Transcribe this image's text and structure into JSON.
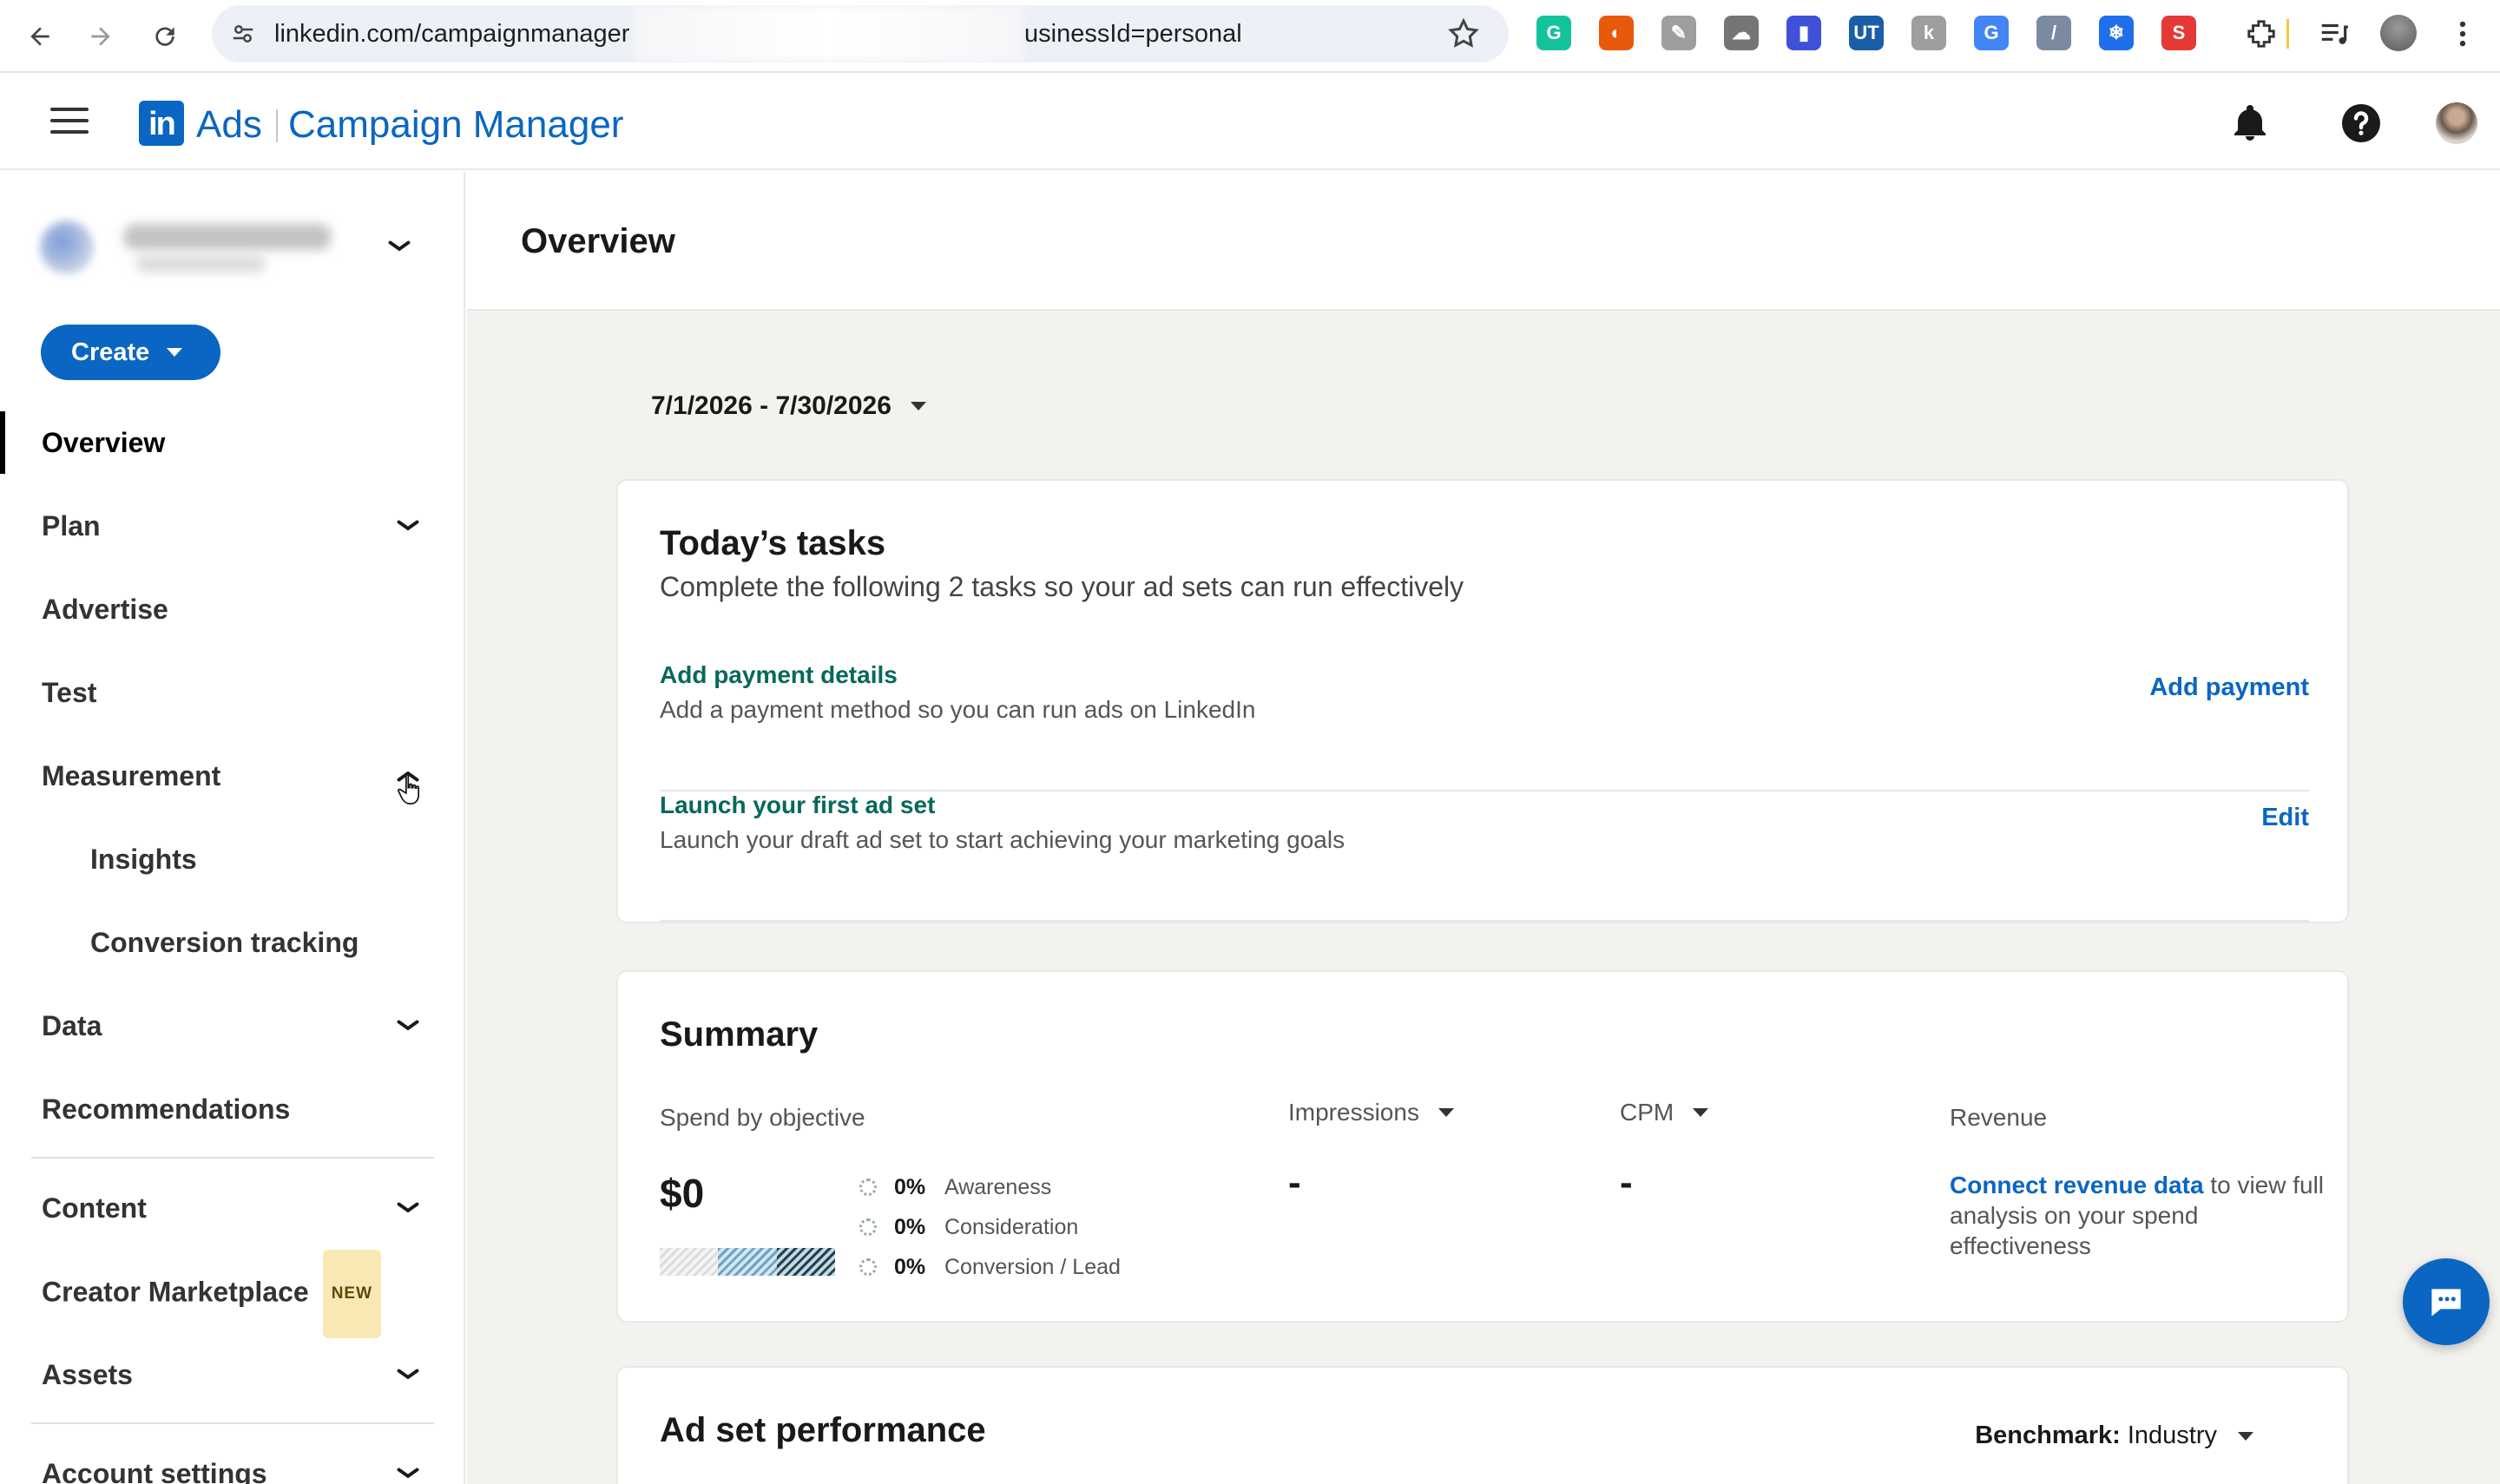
{
  "browser": {
    "url_visible_start": "linkedin.com/campaignmanager",
    "url_visible_end": "usinessId=personal",
    "extensions": [
      {
        "name": "grammarly-icon",
        "color": "#15c39a",
        "glyph": "G"
      },
      {
        "name": "extension-orange-icon",
        "color": "#e8590c",
        "glyph": "◐"
      },
      {
        "name": "extension-notes-icon",
        "color": "#9e9e9e",
        "glyph": "✎"
      },
      {
        "name": "extension-cloud-icon",
        "color": "#757575",
        "glyph": "☁"
      },
      {
        "name": "extension-blue-bookmark-icon",
        "color": "#3f51d8",
        "glyph": "▮"
      },
      {
        "name": "extension-ut-icon",
        "color": "#1a5ea8",
        "glyph": "UT"
      },
      {
        "name": "extension-gray-icon",
        "color": "#9e9e9e",
        "glyph": "k"
      },
      {
        "name": "google-translate-icon",
        "color": "#4285f4",
        "glyph": "G"
      },
      {
        "name": "extension-pen-icon",
        "color": "#7a8aa0",
        "glyph": "/"
      },
      {
        "name": "extension-snowflake-icon",
        "color": "#1f6feb",
        "glyph": "❄"
      },
      {
        "name": "extension-red-s-icon",
        "color": "#e53935",
        "glyph": "S"
      }
    ]
  },
  "header": {
    "logo_text": "in",
    "brand_ads": "Ads",
    "brand_product": "Campaign Manager"
  },
  "sidebar": {
    "create_label": "Create",
    "items": [
      {
        "label": "Overview",
        "active": true,
        "chevron": "none"
      },
      {
        "label": "Plan",
        "chevron": "down"
      },
      {
        "label": "Advertise",
        "chevron": "none"
      },
      {
        "label": "Test",
        "chevron": "none"
      },
      {
        "label": "Measurement",
        "chevron": "up"
      },
      {
        "label": "Insights",
        "sub": true
      },
      {
        "label": "Conversion tracking",
        "sub": true
      },
      {
        "label": "Data",
        "chevron": "down"
      },
      {
        "label": "Recommendations",
        "chevron": "none"
      },
      {
        "label": "Content",
        "chevron": "down"
      },
      {
        "label": "Creator Marketplace",
        "badge": "NEW"
      },
      {
        "label": "Assets",
        "chevron": "down"
      },
      {
        "label": "Account settings",
        "chevron": "down"
      }
    ]
  },
  "main": {
    "title": "Overview",
    "date_range": "7/1/2026 - 7/30/2026",
    "tasks": {
      "title": "Today’s tasks",
      "subtitle": "Complete the following 2 tasks so your ad sets can run effectively",
      "items": [
        {
          "title": "Add payment details",
          "description": "Add a payment method so you can run ads on LinkedIn",
          "action": "Add payment"
        },
        {
          "title": "Launch your first ad set",
          "description": "Launch your draft ad set to start achieving your marketing goals",
          "action": "Edit"
        }
      ]
    },
    "summary": {
      "title": "Summary",
      "spend_label": "Spend by objective",
      "spend_value": "$0",
      "objectives": [
        {
          "pct": "0%",
          "name": "Awareness"
        },
        {
          "pct": "0%",
          "name": "Consideration"
        },
        {
          "pct": "0%",
          "name": "Conversion / Lead"
        }
      ],
      "impressions_label": "Impressions",
      "impressions_value": "-",
      "cpm_label": "CPM",
      "cpm_value": "-",
      "revenue_label": "Revenue",
      "revenue_link": "Connect revenue data",
      "revenue_text": " to view full analysis on your spend effectiveness"
    },
    "performance": {
      "title": "Ad set performance",
      "benchmark_label": "Benchmark:",
      "benchmark_value": "Industry"
    }
  },
  "colors": {
    "brand_blue": "#0a66c2",
    "task_green": "#06695a",
    "page_bg": "#f3f2ef"
  }
}
